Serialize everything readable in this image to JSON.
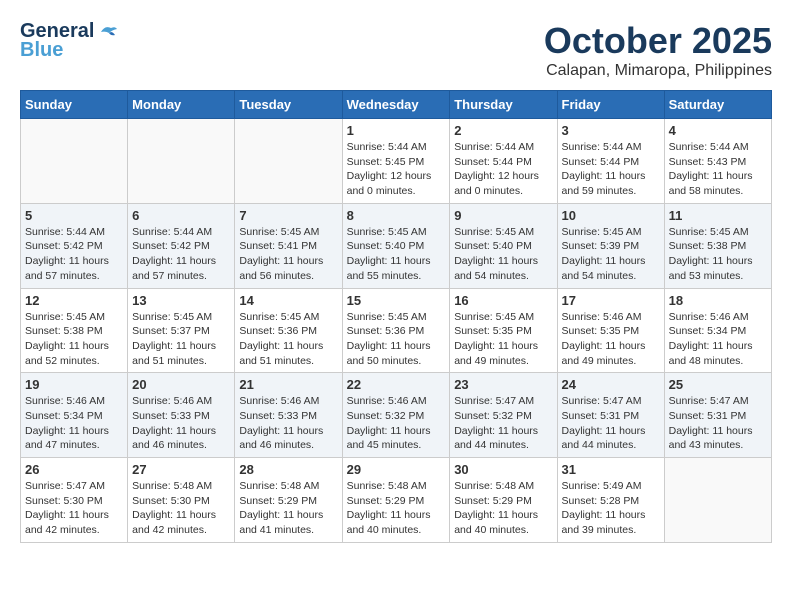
{
  "header": {
    "logo_general": "General",
    "logo_blue": "Blue",
    "title": "October 2025",
    "subtitle": "Calapan, Mimaropa, Philippines"
  },
  "calendar": {
    "days_of_week": [
      "Sunday",
      "Monday",
      "Tuesday",
      "Wednesday",
      "Thursday",
      "Friday",
      "Saturday"
    ],
    "weeks": [
      {
        "days": [
          {
            "number": "",
            "info": ""
          },
          {
            "number": "",
            "info": ""
          },
          {
            "number": "",
            "info": ""
          },
          {
            "number": "1",
            "info": "Sunrise: 5:44 AM\nSunset: 5:45 PM\nDaylight: 12 hours\nand 0 minutes."
          },
          {
            "number": "2",
            "info": "Sunrise: 5:44 AM\nSunset: 5:44 PM\nDaylight: 12 hours\nand 0 minutes."
          },
          {
            "number": "3",
            "info": "Sunrise: 5:44 AM\nSunset: 5:44 PM\nDaylight: 11 hours\nand 59 minutes."
          },
          {
            "number": "4",
            "info": "Sunrise: 5:44 AM\nSunset: 5:43 PM\nDaylight: 11 hours\nand 58 minutes."
          }
        ]
      },
      {
        "days": [
          {
            "number": "5",
            "info": "Sunrise: 5:44 AM\nSunset: 5:42 PM\nDaylight: 11 hours\nand 57 minutes."
          },
          {
            "number": "6",
            "info": "Sunrise: 5:44 AM\nSunset: 5:42 PM\nDaylight: 11 hours\nand 57 minutes."
          },
          {
            "number": "7",
            "info": "Sunrise: 5:45 AM\nSunset: 5:41 PM\nDaylight: 11 hours\nand 56 minutes."
          },
          {
            "number": "8",
            "info": "Sunrise: 5:45 AM\nSunset: 5:40 PM\nDaylight: 11 hours\nand 55 minutes."
          },
          {
            "number": "9",
            "info": "Sunrise: 5:45 AM\nSunset: 5:40 PM\nDaylight: 11 hours\nand 54 minutes."
          },
          {
            "number": "10",
            "info": "Sunrise: 5:45 AM\nSunset: 5:39 PM\nDaylight: 11 hours\nand 54 minutes."
          },
          {
            "number": "11",
            "info": "Sunrise: 5:45 AM\nSunset: 5:38 PM\nDaylight: 11 hours\nand 53 minutes."
          }
        ]
      },
      {
        "days": [
          {
            "number": "12",
            "info": "Sunrise: 5:45 AM\nSunset: 5:38 PM\nDaylight: 11 hours\nand 52 minutes."
          },
          {
            "number": "13",
            "info": "Sunrise: 5:45 AM\nSunset: 5:37 PM\nDaylight: 11 hours\nand 51 minutes."
          },
          {
            "number": "14",
            "info": "Sunrise: 5:45 AM\nSunset: 5:36 PM\nDaylight: 11 hours\nand 51 minutes."
          },
          {
            "number": "15",
            "info": "Sunrise: 5:45 AM\nSunset: 5:36 PM\nDaylight: 11 hours\nand 50 minutes."
          },
          {
            "number": "16",
            "info": "Sunrise: 5:45 AM\nSunset: 5:35 PM\nDaylight: 11 hours\nand 49 minutes."
          },
          {
            "number": "17",
            "info": "Sunrise: 5:46 AM\nSunset: 5:35 PM\nDaylight: 11 hours\nand 49 minutes."
          },
          {
            "number": "18",
            "info": "Sunrise: 5:46 AM\nSunset: 5:34 PM\nDaylight: 11 hours\nand 48 minutes."
          }
        ]
      },
      {
        "days": [
          {
            "number": "19",
            "info": "Sunrise: 5:46 AM\nSunset: 5:34 PM\nDaylight: 11 hours\nand 47 minutes."
          },
          {
            "number": "20",
            "info": "Sunrise: 5:46 AM\nSunset: 5:33 PM\nDaylight: 11 hours\nand 46 minutes."
          },
          {
            "number": "21",
            "info": "Sunrise: 5:46 AM\nSunset: 5:33 PM\nDaylight: 11 hours\nand 46 minutes."
          },
          {
            "number": "22",
            "info": "Sunrise: 5:46 AM\nSunset: 5:32 PM\nDaylight: 11 hours\nand 45 minutes."
          },
          {
            "number": "23",
            "info": "Sunrise: 5:47 AM\nSunset: 5:32 PM\nDaylight: 11 hours\nand 44 minutes."
          },
          {
            "number": "24",
            "info": "Sunrise: 5:47 AM\nSunset: 5:31 PM\nDaylight: 11 hours\nand 44 minutes."
          },
          {
            "number": "25",
            "info": "Sunrise: 5:47 AM\nSunset: 5:31 PM\nDaylight: 11 hours\nand 43 minutes."
          }
        ]
      },
      {
        "days": [
          {
            "number": "26",
            "info": "Sunrise: 5:47 AM\nSunset: 5:30 PM\nDaylight: 11 hours\nand 42 minutes."
          },
          {
            "number": "27",
            "info": "Sunrise: 5:48 AM\nSunset: 5:30 PM\nDaylight: 11 hours\nand 42 minutes."
          },
          {
            "number": "28",
            "info": "Sunrise: 5:48 AM\nSunset: 5:29 PM\nDaylight: 11 hours\nand 41 minutes."
          },
          {
            "number": "29",
            "info": "Sunrise: 5:48 AM\nSunset: 5:29 PM\nDaylight: 11 hours\nand 40 minutes."
          },
          {
            "number": "30",
            "info": "Sunrise: 5:48 AM\nSunset: 5:29 PM\nDaylight: 11 hours\nand 40 minutes."
          },
          {
            "number": "31",
            "info": "Sunrise: 5:49 AM\nSunset: 5:28 PM\nDaylight: 11 hours\nand 39 minutes."
          },
          {
            "number": "",
            "info": ""
          }
        ]
      }
    ]
  }
}
